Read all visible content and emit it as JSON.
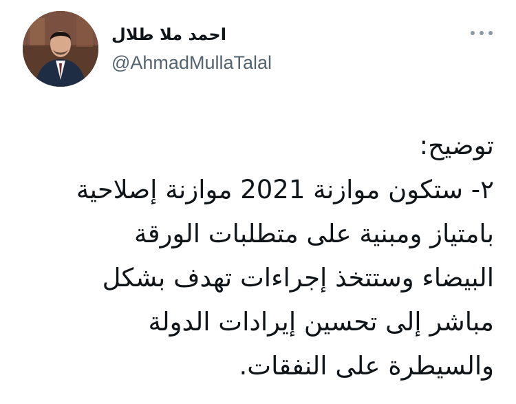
{
  "author": {
    "display_name": "احمد ملا طلال",
    "handle": "@AhmadMullaTalal",
    "avatar_icon": "profile-photo"
  },
  "more_icon": "more-horizontal-icon",
  "tweet": {
    "lines": [
      "توضيح:",
      "٢- ستكون موازنة 2021 موازنة إصلاحية",
      "بامتياز ومبنية على متطلبات الورقة",
      "البيضاء وستتخذ إجراءات تهدف بشكل",
      "مباشر إلى تحسين إيرادات الدولة",
      "والسيطرة على النفقات."
    ]
  },
  "colors": {
    "text": "#0f1419",
    "secondary": "#536471"
  }
}
